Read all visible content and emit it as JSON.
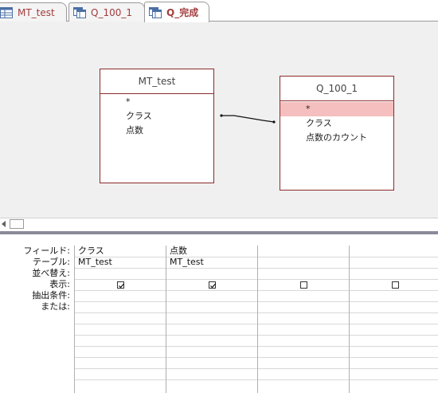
{
  "tabs": [
    {
      "label": "MT_test",
      "icon": "table-icon",
      "active": false
    },
    {
      "label": "Q_100_1",
      "icon": "query-icon",
      "active": false
    },
    {
      "label": "Q_完成",
      "icon": "query-icon",
      "active": true
    }
  ],
  "design": {
    "tables": [
      {
        "title": "MT_test",
        "fields": [
          "*",
          "クラス",
          "点数"
        ]
      },
      {
        "title": "Q_100_1",
        "fields": [
          "*",
          "クラス",
          "点数のカウント"
        ]
      }
    ]
  },
  "qbe": {
    "row_labels": [
      "フィールド:",
      "テーブル:",
      "並べ替え:",
      "表示:",
      "抽出条件:",
      "または:"
    ],
    "columns": [
      {
        "field": "クラス",
        "table": "MT_test",
        "show": true
      },
      {
        "field": "点数",
        "table": "MT_test",
        "show": true
      },
      {
        "field": "",
        "table": "",
        "show": false
      },
      {
        "field": "",
        "table": "",
        "show": false
      }
    ]
  }
}
